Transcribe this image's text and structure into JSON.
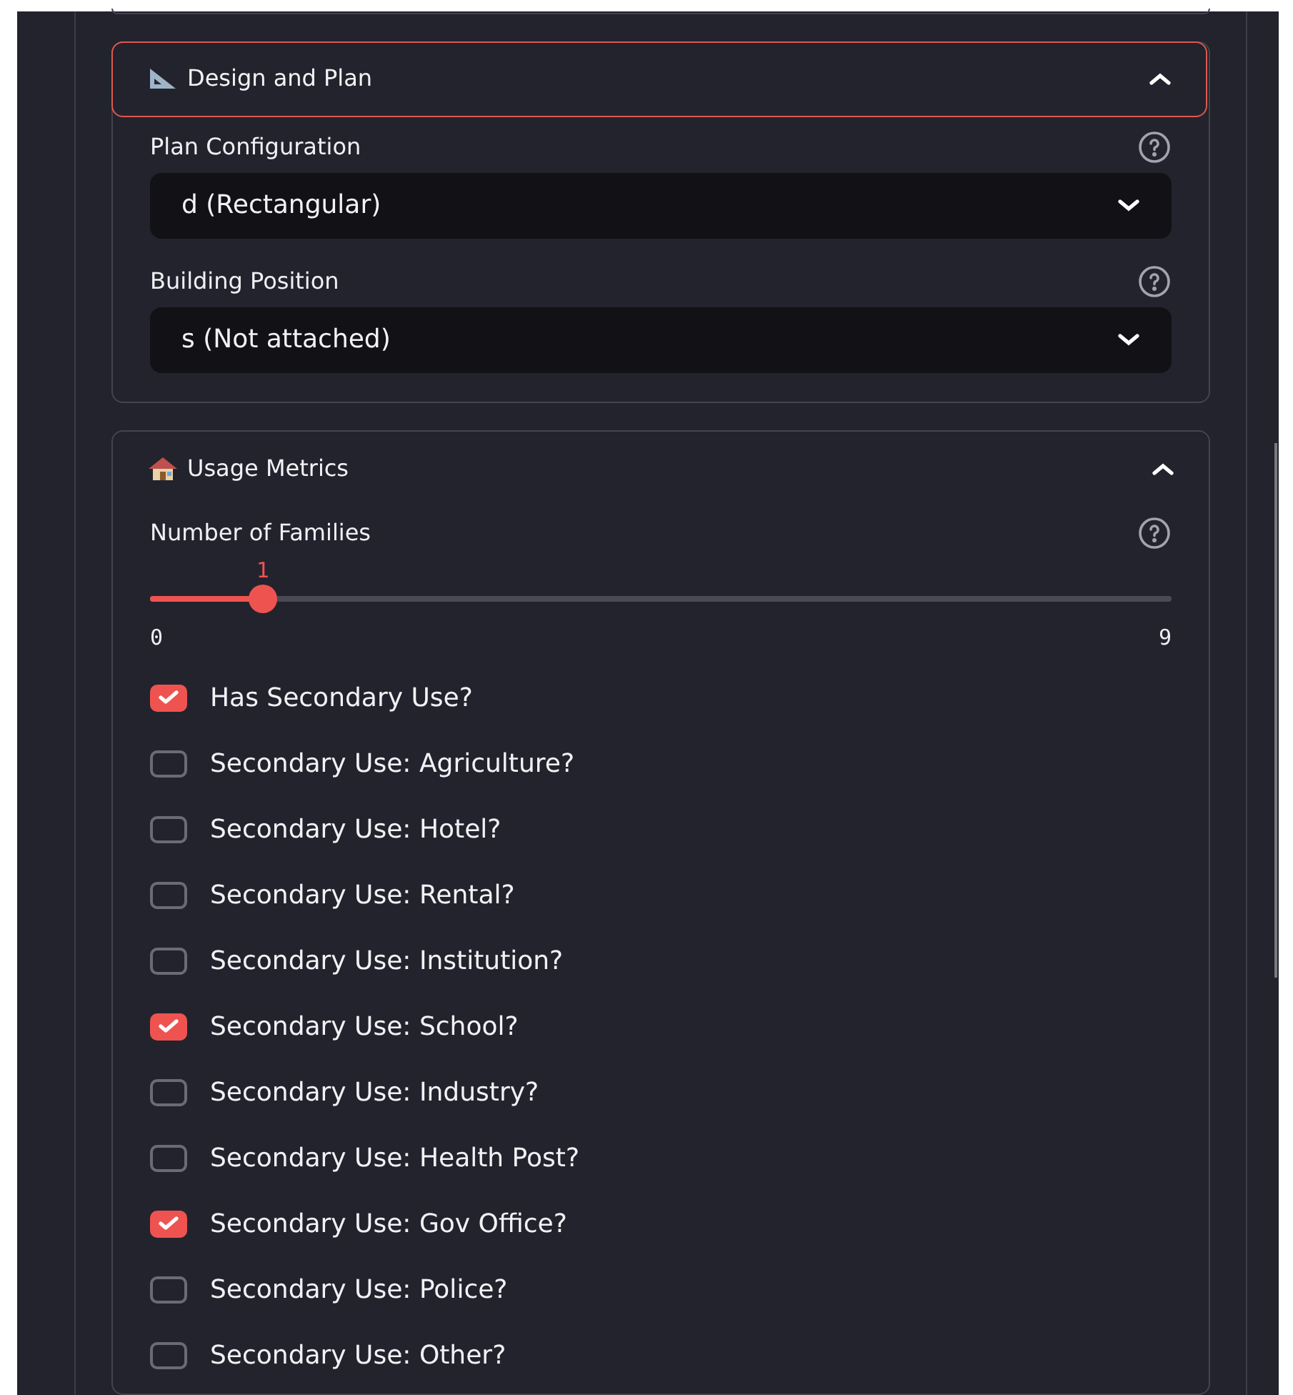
{
  "sections": [
    {
      "title": "Design and Plan",
      "expanded": true,
      "focused": true,
      "fields": [
        {
          "kind": "select",
          "label": "Plan Configuration",
          "value": "d (Rectangular)"
        },
        {
          "kind": "select",
          "label": "Building Position",
          "value": "s (Not attached)"
        }
      ]
    },
    {
      "title": "Usage Metrics",
      "expanded": true,
      "focused": false,
      "fields": [
        {
          "kind": "slider",
          "label": "Number of Families",
          "value": "1",
          "min": "0",
          "max": "9",
          "level": 0.111
        },
        {
          "kind": "checkbox",
          "label": "Has Secondary Use?",
          "checked": true
        },
        {
          "kind": "checkbox",
          "label": "Secondary Use: Agriculture?",
          "checked": false
        },
        {
          "kind": "checkbox",
          "label": "Secondary Use: Hotel?",
          "checked": false
        },
        {
          "kind": "checkbox",
          "label": "Secondary Use: Rental?",
          "checked": false
        },
        {
          "kind": "checkbox",
          "label": "Secondary Use: Institution?",
          "checked": false
        },
        {
          "kind": "checkbox",
          "label": "Secondary Use: School?",
          "checked": true
        },
        {
          "kind": "checkbox",
          "label": "Secondary Use: Industry?",
          "checked": false
        },
        {
          "kind": "checkbox",
          "label": "Secondary Use: Health Post?",
          "checked": false
        },
        {
          "kind": "checkbox",
          "label": "Secondary Use: Gov Office?",
          "checked": true
        },
        {
          "kind": "checkbox",
          "label": "Secondary Use: Police?",
          "checked": false
        },
        {
          "kind": "checkbox",
          "label": "Secondary Use: Other?",
          "checked": false
        }
      ]
    }
  ]
}
